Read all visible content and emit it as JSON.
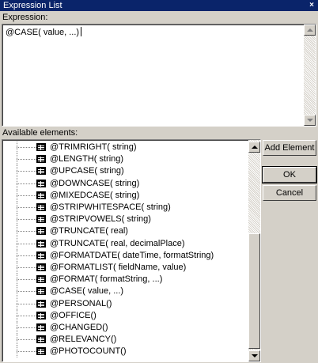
{
  "window": {
    "title": "Expression List",
    "close_glyph": "×"
  },
  "expression": {
    "label": "Expression:",
    "value": "@CASE( value, ...)"
  },
  "available": {
    "label": "Available elements:",
    "items": [
      "@TRIMRIGHT( string)",
      "@LENGTH( string)",
      "@UPCASE( string)",
      "@DOWNCASE( string)",
      "@MIXEDCASE( string)",
      "@STRIPWHITESPACE( string)",
      "@STRIPVOWELS( string)",
      "@TRUNCATE( real)",
      "@TRUNCATE( real, decimalPlace)",
      "@FORMATDATE( dateTime, formatString)",
      "@FORMATLIST( fieldName, value)",
      "@FORMAT( formatString, ...)",
      "@CASE( value, ...)",
      "@PERSONAL()",
      "@OFFICE()",
      "@CHANGED()",
      "@RELEVANCY()",
      "@PHOTOCOUNT()"
    ]
  },
  "buttons": {
    "add_element": "Add Element",
    "ok": "OK",
    "cancel": "Cancel"
  }
}
